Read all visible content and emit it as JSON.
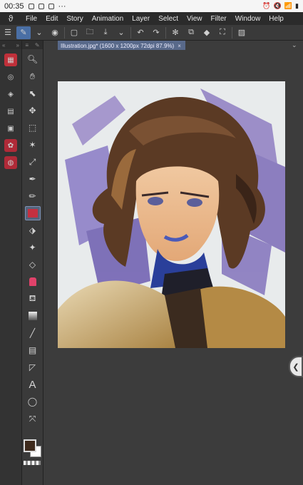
{
  "status": {
    "time": "00:35",
    "ellipsis": "···",
    "battery": "64%"
  },
  "menu": {
    "items": [
      "File",
      "Edit",
      "Story",
      "Animation",
      "Layer",
      "Select",
      "View",
      "Filter",
      "Window",
      "Help"
    ]
  },
  "document": {
    "tab_title": "Illustration.jpg* (1600 x 1200px 72dpi 87.9%)",
    "close_symbol": "×"
  },
  "colors": {
    "main_color": "#3e2a1c",
    "sub_color": "#ffffff",
    "active_tool_bg": "#55637a",
    "tab_bg": "#58698a"
  },
  "icons": {
    "toolbar": [
      "menu-icon",
      "rotate-icon",
      "chevron-down-icon",
      "layer-icon",
      "new-file-icon",
      "open-file-icon",
      "save-icon",
      "chevron-down-icon",
      "undo-icon",
      "redo-icon",
      "loading-icon",
      "copy-icon",
      "fill-icon",
      "transform-icon",
      "crop-icon"
    ],
    "tools": [
      "zoom-icon",
      "hand-icon",
      "object-icon",
      "move-icon",
      "selection-icon",
      "magic-wand-icon",
      "eyedropper-icon",
      "pen-icon",
      "pencil-icon",
      "brush-icon",
      "airbrush-icon",
      "sparkle-icon",
      "eraser-icon",
      "blend-icon",
      "fill-icon",
      "gradient-icon",
      "line-icon",
      "frame-icon",
      "ruler-icon",
      "text-icon",
      "balloon-icon",
      "correction-icon"
    ]
  }
}
